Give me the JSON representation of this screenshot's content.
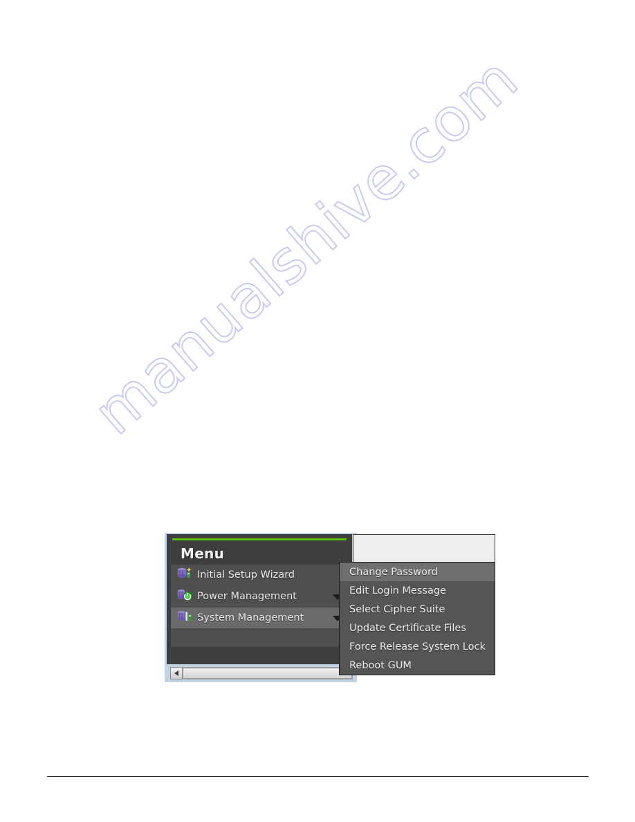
{
  "watermark": {
    "text": "manualshive.com",
    "color": "#c6c9f0"
  },
  "colors": {
    "accent_green": "#5bc000",
    "menu_background": "#3e3e3e",
    "menu_row": "#4f4f4f",
    "menu_row_selected": "#6a6a6a",
    "submenu_background": "#555555",
    "submenu_highlight": "#6f6f6f",
    "widget_chrome": "#c3d3e3",
    "content_panel": "#eeeeee",
    "text_light": "#ececec"
  },
  "menu": {
    "title": "Menu",
    "items": [
      {
        "label": "Initial Setup Wizard",
        "icon": "server-wizard-icon",
        "has_arrow": false,
        "selected": false
      },
      {
        "label": "Power Management",
        "icon": "server-power-icon",
        "has_arrow": true,
        "selected": false
      },
      {
        "label": "System Management",
        "icon": "server-tools-icon",
        "has_arrow": true,
        "selected": true
      }
    ]
  },
  "submenu": {
    "items": [
      {
        "label": "Change Password",
        "highlighted": true
      },
      {
        "label": "Edit Login Message",
        "highlighted": false
      },
      {
        "label": "Select Cipher Suite",
        "highlighted": false
      },
      {
        "label": "Update Certificate Files",
        "highlighted": false
      },
      {
        "label": "Force Release System Lock",
        "highlighted": false
      },
      {
        "label": "Reboot GUM",
        "highlighted": false
      }
    ]
  },
  "scrollbar": {
    "left_arrow_icon": "triangle-left-icon",
    "orientation": "horizontal"
  }
}
